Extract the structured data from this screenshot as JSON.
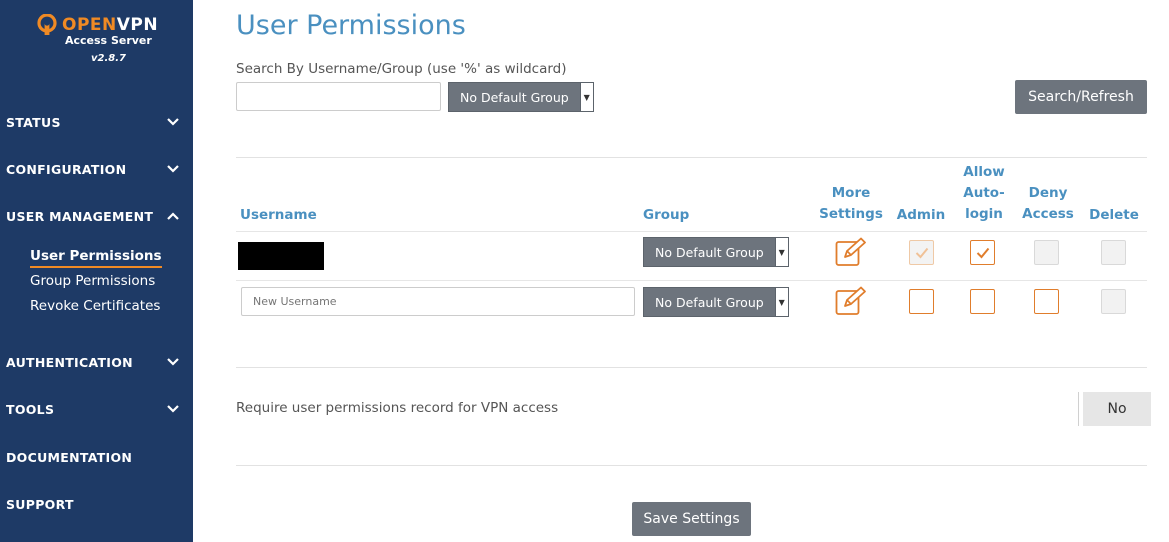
{
  "brand": {
    "name_open": "OPEN",
    "name_vpn": "VPN",
    "subtitle": "Access Server",
    "version": "v2.8.7"
  },
  "nav": {
    "status": "STATUS",
    "configuration": "CONFIGURATION",
    "user_management": "USER MANAGEMENT",
    "sub": {
      "user_permissions": "User Permissions",
      "group_permissions": "Group Permissions",
      "revoke_certificates": "Revoke Certificates"
    },
    "authentication": "AUTHENTICATION",
    "tools": "TOOLS",
    "documentation": "DOCUMENTATION",
    "support": "SUPPORT"
  },
  "page": {
    "title": "User Permissions",
    "search_label": "Search By Username/Group (use '%' as wildcard)",
    "search_value": "",
    "search_group": "No Default Group",
    "search_button": "Search/Refresh"
  },
  "table": {
    "headers": {
      "username": "Username",
      "group": "Group",
      "more_settings": [
        "More",
        "Settings"
      ],
      "admin": "Admin",
      "allow_autologin": [
        "Allow",
        "Auto-",
        "login"
      ],
      "deny_access": [
        "Deny",
        "Access"
      ],
      "delete": "Delete"
    },
    "rows": [
      {
        "group": "No Default Group",
        "admin": true,
        "admin_disabled": true,
        "autologin": true,
        "deny": false,
        "deny_disabled": true,
        "delete": false,
        "delete_disabled": true
      },
      {
        "placeholder": "New Username",
        "group": "No Default Group",
        "admin": false,
        "autologin": false,
        "deny": false,
        "delete": false,
        "delete_disabled": true
      }
    ]
  },
  "require": {
    "label": "Require user permissions record for VPN access",
    "value": "No"
  },
  "save_button": "Save Settings",
  "colors": {
    "sidebar": "#1e3a66",
    "accent_blue": "#4a90c0",
    "accent_orange": "#e07d2c",
    "button_gray": "#6d747d"
  }
}
